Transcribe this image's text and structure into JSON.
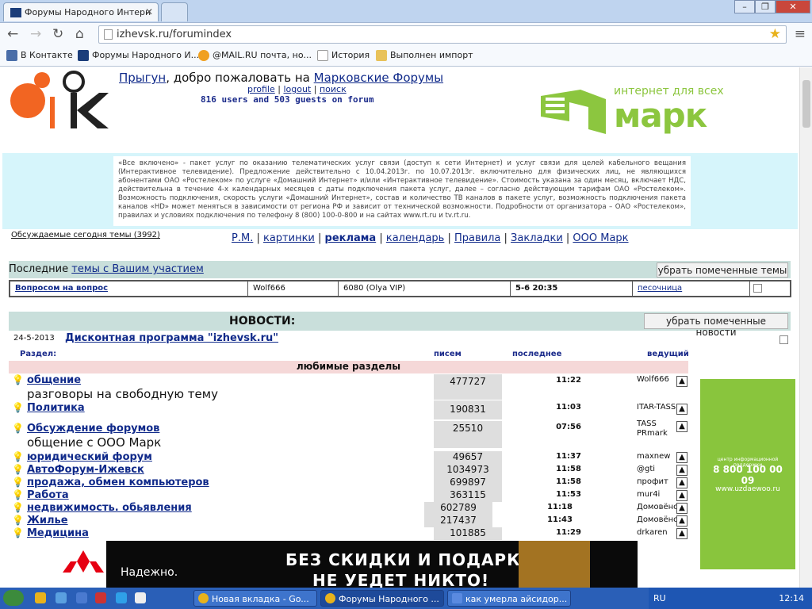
{
  "browser": {
    "tab_active": "Форумы Народного Интерн",
    "url": "izhevsk.ru/forumindex",
    "bookmarks": [
      "В Контакте",
      "Форумы Народного И...",
      "@MAIL.RU почта, но...",
      "История",
      "Выполнен импорт"
    ]
  },
  "header": {
    "user": "Прыгун",
    "welcome": ", добро пожаловать на ",
    "forum_name": "Марковские Форумы",
    "links": [
      "profile",
      "logout",
      "поиск"
    ],
    "online": "816 users and 503 guests on forum"
  },
  "mark_logo": {
    "line1": "интернет для всех",
    "line2": "марк"
  },
  "promo_text": "«Все включено» - пакет услуг по оказанию телематических услуг связи (доступ к сети Интернет) и услуг связи для целей кабельного вещания (Интерактивное телевидение). Предложение действительно с 10.04.2013г. по 10.07.2013г. включительно для физических лиц, не являющихся абонентами ОАО «Ростелеком» по услуге «Домашний Интернет» и/или «Интерактивное телевидение». Стоимость указана за один месяц, включает НДС, действительна в течение 4-х календарных месяцев с даты подключения пакета услуг, далее – согласно действующим тарифам ОАО «Ростелеком». Возможность подключения, скорость услуги «Домашний Интернет», состав и количество ТВ каналов в пакете услуг, возможность подключения пакета каналов «HD» может меняться в зависимости от региона РФ и зависит от технической возможности. Подробности от организатора – ОАО «Ростелеком», правилах и условиях подключения по телефону 8 (800) 100-0-800 и на сайтах www.rt.ru и tv.rt.ru.",
  "today_topics": "Обсуждаемые сегодня темы (3992)",
  "nav": {
    "rm": "Р.М.",
    "pics": "картинки",
    "ads": "реклама",
    "calendar": "календарь",
    "rules": "Правила",
    "bookmarks": "Закладки",
    "ooo": "ООО Марк"
  },
  "last_topics": {
    "title_prefix": "Последние ",
    "title_link": "темы с Вашим участием",
    "button": "убрать помеченные темы",
    "row": {
      "topic": "Вопросом на вопрос",
      "author": "Wolf666",
      "count": "6080 (Olya VIP)",
      "time": "5-6 20:35",
      "forum": "песочница"
    }
  },
  "news": {
    "title": "НОВОСТИ:",
    "button": "убрать помеченные новости",
    "date": "24-5-2013",
    "item": "Дисконтная программа \"izhevsk.ru\""
  },
  "table_headers": {
    "section": "Раздел:",
    "posts": "писем",
    "last": "последнее",
    "mod": "ведущий"
  },
  "fav_title": "любимые разделы",
  "forums": [
    {
      "name": "общение",
      "sub": "разговоры на свободную тему",
      "count": "477727",
      "time": "11:22",
      "mod": "Wolf666"
    },
    {
      "name": "Политика",
      "sub": "",
      "count": "190831",
      "time": "11:03",
      "mod": "ITAR-TASS"
    },
    {
      "name": "Обсуждение форумов",
      "sub": "общение с ООО Марк",
      "count": "25510",
      "time": "07:56",
      "mod": "PRmark"
    },
    {
      "name": "юридический форум",
      "sub": "",
      "count": "49657",
      "time": "11:37",
      "mod": "maxnew"
    },
    {
      "name": "АвтоФорум-Ижевск",
      "sub": "",
      "count": "1034973",
      "time": "11:58",
      "mod": "@gti"
    },
    {
      "name": "продажа, обмен компьютеров",
      "sub": "",
      "count": "699897",
      "time": "11:58",
      "mod": "профит"
    },
    {
      "name": "Работа",
      "sub": "",
      "count": "363115",
      "time": "11:53",
      "mod": "mur4i"
    },
    {
      "name": "недвижимость. обьявления",
      "sub": "",
      "count": "602789",
      "time": "11:18",
      "mod": "Домовёнок"
    },
    {
      "name": "Жилье",
      "sub": "",
      "count": "217437",
      "time": "11:43",
      "mod": "Домовёнок"
    },
    {
      "name": "Медицина",
      "sub": "",
      "count": "101885",
      "time": "11:29",
      "mod": "drkaren"
    }
  ],
  "banner": {
    "w1": "Надежно.",
    "w2": "БЕЗ СКИДКИ И ПОДАРКА",
    "w3": "НЕ УЕДЕТ НИКТО!"
  },
  "side_ad": {
    "line1": "центр информационной поддержки",
    "phone": "8 800 100 00 09",
    "site": "www.uzdaewoo.ru"
  },
  "taskbar": {
    "tasks": [
      "Новая вкладка - Go...",
      "Форумы Народного ...",
      "как умерла айсидор..."
    ],
    "lang": "RU",
    "clock": "12:14"
  }
}
